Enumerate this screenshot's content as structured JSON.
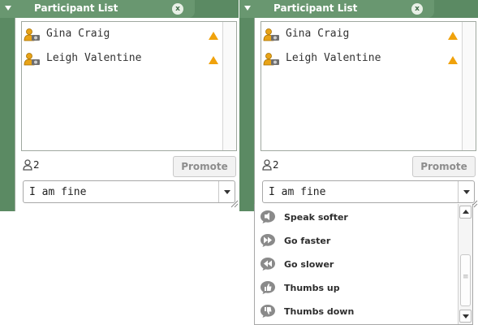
{
  "panels": [
    {
      "title": "Participant List",
      "close_label": "x",
      "participants": [
        {
          "name": "Gina Craig"
        },
        {
          "name": "Leigh Valentine"
        }
      ],
      "count": "2",
      "promote_label": "Promote",
      "status_value": "I am fine"
    },
    {
      "title": "Participant List",
      "close_label": "x",
      "participants": [
        {
          "name": "Gina Craig"
        },
        {
          "name": "Leigh Valentine"
        }
      ],
      "count": "2",
      "promote_label": "Promote",
      "status_value": "I am fine"
    }
  ],
  "status_dropdown": {
    "options": [
      {
        "label": "Speak softer",
        "icon": "speak-softer-icon"
      },
      {
        "label": "Go faster",
        "icon": "go-faster-icon"
      },
      {
        "label": "Go slower",
        "icon": "go-slower-icon"
      },
      {
        "label": "Thumbs up",
        "icon": "thumbs-up-icon"
      },
      {
        "label": "Thumbs down",
        "icon": "thumbs-down-icon"
      }
    ]
  },
  "colors": {
    "panel_green": "#5b8a63",
    "warning_orange": "#f0a20c",
    "avatar_gold": "#e8a317",
    "icon_gray": "#8a8a8a"
  }
}
